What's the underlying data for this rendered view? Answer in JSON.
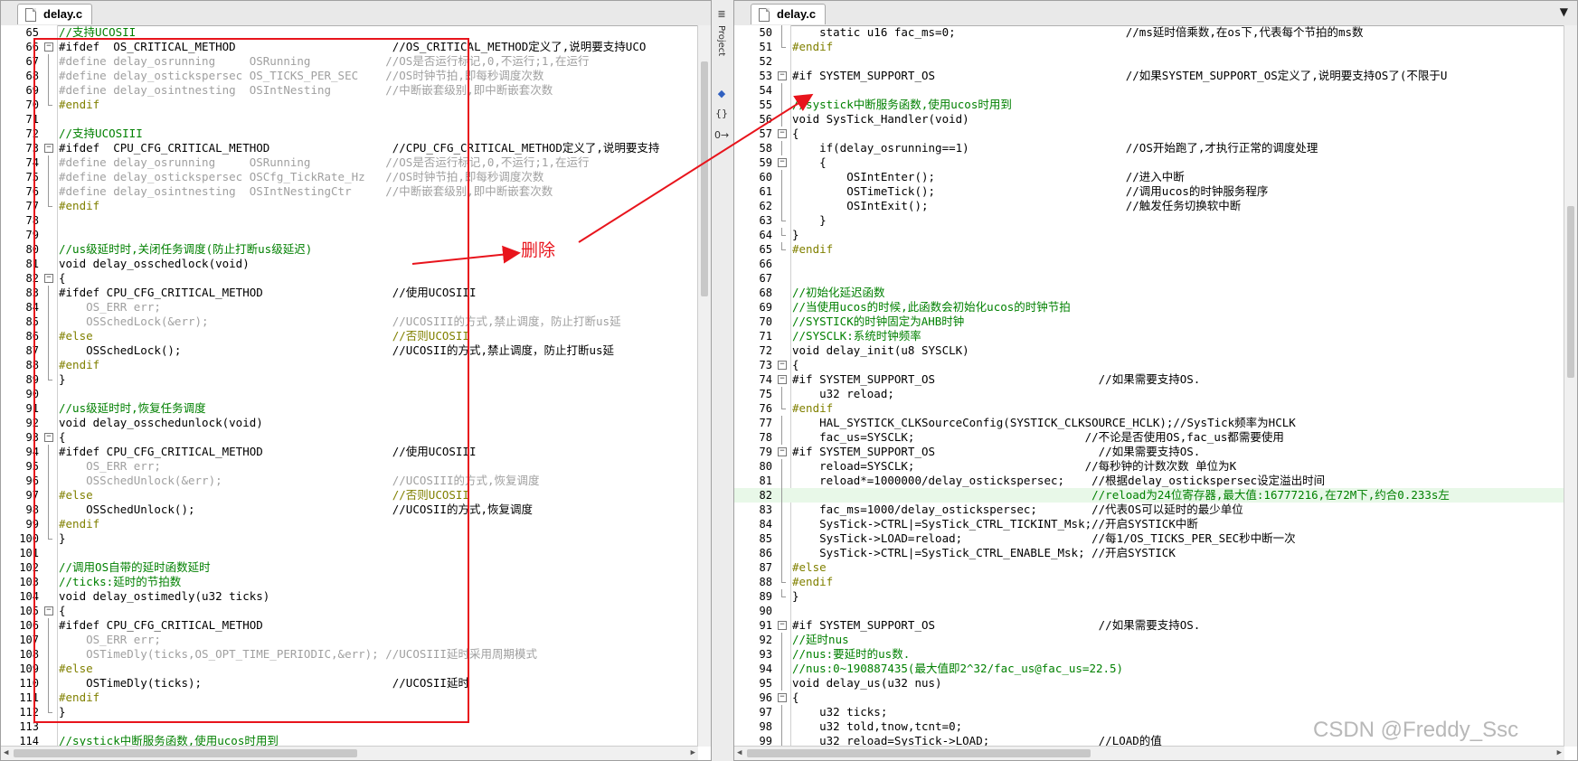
{
  "left_pane": {
    "tab": "delay.c",
    "lines": [
      {
        "n": "65",
        "t": "//支持UCOSII",
        "c": "#008000",
        "f": ""
      },
      {
        "n": "66",
        "t": "#ifdef  OS_CRITICAL_METHOD                       //OS_CRITICAL_METHOD定义了,说明要支持UCO",
        "c": "#000000",
        "f": "box"
      },
      {
        "n": "67",
        "t": "#define delay_osrunning     OSRunning           //OS是否运行标记,0,不运行;1,在运行",
        "c": "#a0a0a0",
        "f": "bar"
      },
      {
        "n": "68",
        "t": "#define delay_ostickspersec OS_TICKS_PER_SEC    //OS时钟节拍,即每秒调度次数",
        "c": "#a0a0a0",
        "f": "bar"
      },
      {
        "n": "69",
        "t": "#define delay_osintnesting  OSIntNesting        //中断嵌套级别,即中断嵌套次数",
        "c": "#a0a0a0",
        "f": "bar"
      },
      {
        "n": "70",
        "t": "#endif",
        "c": "#808000",
        "f": "end"
      },
      {
        "n": "71",
        "t": "",
        "c": "#000000",
        "f": ""
      },
      {
        "n": "72",
        "t": "//支持UCOSIII",
        "c": "#008000",
        "f": ""
      },
      {
        "n": "73",
        "t": "#ifdef  CPU_CFG_CRITICAL_METHOD                  //CPU_CFG_CRITICAL_METHOD定义了,说明要支持",
        "c": "#000000",
        "f": "box"
      },
      {
        "n": "74",
        "t": "#define delay_osrunning     OSRunning           //OS是否运行标记,0,不运行;1,在运行",
        "c": "#a0a0a0",
        "f": "bar"
      },
      {
        "n": "75",
        "t": "#define delay_ostickspersec OSCfg_TickRate_Hz   //OS时钟节拍,即每秒调度次数",
        "c": "#a0a0a0",
        "f": "bar"
      },
      {
        "n": "76",
        "t": "#define delay_osintnesting  OSIntNestingCtr     //中断嵌套级别,即中断嵌套次数",
        "c": "#a0a0a0",
        "f": "bar"
      },
      {
        "n": "77",
        "t": "#endif",
        "c": "#808000",
        "f": "end"
      },
      {
        "n": "78",
        "t": "",
        "c": "#000000",
        "f": ""
      },
      {
        "n": "79",
        "t": "",
        "c": "#000000",
        "f": ""
      },
      {
        "n": "80",
        "t": "//us级延时时,关闭任务调度(防止打断us级延迟)",
        "c": "#008000",
        "f": ""
      },
      {
        "n": "81",
        "t": "void delay_osschedlock(void)",
        "c": "#000000",
        "f": ""
      },
      {
        "n": "82",
        "t": "{",
        "c": "#000000",
        "f": "box"
      },
      {
        "n": "83",
        "t": "#ifdef CPU_CFG_CRITICAL_METHOD                   //使用UCOSIII",
        "c": "#000000",
        "f": "bar"
      },
      {
        "n": "84",
        "t": "    OS_ERR err;",
        "c": "#a0a0a0",
        "f": "bar"
      },
      {
        "n": "85",
        "t": "    OSSchedLock(&err);                           //UCOSIII的方式,禁止调度，防止打断us延",
        "c": "#a0a0a0",
        "f": "bar"
      },
      {
        "n": "86",
        "t": "#else                                            //否则UCOSII",
        "c": "#808000",
        "f": "bar"
      },
      {
        "n": "87",
        "t": "    OSSchedLock();                               //UCOSII的方式,禁止调度，防止打断us延",
        "c": "#000000",
        "f": "bar"
      },
      {
        "n": "88",
        "t": "#endif",
        "c": "#808000",
        "f": "bar"
      },
      {
        "n": "89",
        "t": "}",
        "c": "#000000",
        "f": "end"
      },
      {
        "n": "90",
        "t": "",
        "c": "#000000",
        "f": ""
      },
      {
        "n": "91",
        "t": "//us级延时时,恢复任务调度",
        "c": "#008000",
        "f": ""
      },
      {
        "n": "92",
        "t": "void delay_osschedunlock(void)",
        "c": "#000000",
        "f": ""
      },
      {
        "n": "93",
        "t": "{",
        "c": "#000000",
        "f": "box"
      },
      {
        "n": "94",
        "t": "#ifdef CPU_CFG_CRITICAL_METHOD                   //使用UCOSIII",
        "c": "#000000",
        "f": "bar"
      },
      {
        "n": "95",
        "t": "    OS_ERR err;",
        "c": "#a0a0a0",
        "f": "bar"
      },
      {
        "n": "96",
        "t": "    OSSchedUnlock(&err);                         //UCOSIII的方式,恢复调度",
        "c": "#a0a0a0",
        "f": "bar"
      },
      {
        "n": "97",
        "t": "#else                                            //否则UCOSII",
        "c": "#808000",
        "f": "bar"
      },
      {
        "n": "98",
        "t": "    OSSchedUnlock();                             //UCOSII的方式,恢复调度",
        "c": "#000000",
        "f": "bar"
      },
      {
        "n": "99",
        "t": "#endif",
        "c": "#808000",
        "f": "bar"
      },
      {
        "n": "100",
        "t": "}",
        "c": "#000000",
        "f": "end"
      },
      {
        "n": "101",
        "t": "",
        "c": "#000000",
        "f": ""
      },
      {
        "n": "102",
        "t": "//调用OS自带的延时函数延时",
        "c": "#008000",
        "f": ""
      },
      {
        "n": "103",
        "t": "//ticks:延时的节拍数",
        "c": "#008000",
        "f": ""
      },
      {
        "n": "104",
        "t": "void delay_ostimedly(u32 ticks)",
        "c": "#000000",
        "f": ""
      },
      {
        "n": "105",
        "t": "{",
        "c": "#000000",
        "f": "box"
      },
      {
        "n": "106",
        "t": "#ifdef CPU_CFG_CRITICAL_METHOD",
        "c": "#000000",
        "f": "bar"
      },
      {
        "n": "107",
        "t": "    OS_ERR err;",
        "c": "#a0a0a0",
        "f": "bar"
      },
      {
        "n": "108",
        "t": "    OSTimeDly(ticks,OS_OPT_TIME_PERIODIC,&err); //UCOSIII延时采用周期模式",
        "c": "#a0a0a0",
        "f": "bar"
      },
      {
        "n": "109",
        "t": "#else",
        "c": "#808000",
        "f": "bar"
      },
      {
        "n": "110",
        "t": "    OSTimeDly(ticks);                            //UCOSII延时",
        "c": "#000000",
        "f": "bar"
      },
      {
        "n": "111",
        "t": "#endif",
        "c": "#808000",
        "f": "bar"
      },
      {
        "n": "112",
        "t": "}",
        "c": "#000000",
        "f": "end"
      },
      {
        "n": "113",
        "t": "",
        "c": "#000000",
        "f": ""
      },
      {
        "n": "114",
        "t": "//systick中断服务函数,使用ucos时用到",
        "c": "#008000",
        "f": ""
      }
    ]
  },
  "right_pane": {
    "tab": "delay.c",
    "lines": [
      {
        "n": "50",
        "t": "    static u16 fac_ms=0;                         //ms延时倍乘数,在os下,代表每个节拍的ms数",
        "c": "#000000",
        "f": "bar"
      },
      {
        "n": "51",
        "t": "#endif",
        "c": "#808000",
        "f": "end"
      },
      {
        "n": "52",
        "t": "",
        "c": "#000000",
        "f": ""
      },
      {
        "n": "53",
        "t": "#if SYSTEM_SUPPORT_OS                            //如果SYSTEM_SUPPORT_OS定义了,说明要支持OS了(不限于U",
        "c": "#000000",
        "f": "box"
      },
      {
        "n": "54",
        "t": "",
        "c": "#000000",
        "f": "bar"
      },
      {
        "n": "55",
        "t": "//systick中断服务函数,使用ucos时用到",
        "c": "#008000",
        "f": "bar"
      },
      {
        "n": "56",
        "t": "void SysTick_Handler(void)",
        "c": "#000000",
        "f": "bar"
      },
      {
        "n": "57",
        "t": "{",
        "c": "#000000",
        "f": "box"
      },
      {
        "n": "58",
        "t": "    if(delay_osrunning==1)                       //OS开始跑了,才执行正常的调度处理",
        "c": "#000000",
        "f": "bar"
      },
      {
        "n": "59",
        "t": "    {",
        "c": "#000000",
        "f": "box"
      },
      {
        "n": "60",
        "t": "        OSIntEnter();                            //进入中断",
        "c": "#000000",
        "f": "bar"
      },
      {
        "n": "61",
        "t": "        OSTimeTick();                            //调用ucos的时钟服务程序",
        "c": "#000000",
        "f": "bar"
      },
      {
        "n": "62",
        "t": "        OSIntExit();                             //触发任务切换软中断",
        "c": "#000000",
        "f": "bar"
      },
      {
        "n": "63",
        "t": "    }",
        "c": "#000000",
        "f": "end"
      },
      {
        "n": "64",
        "t": "}",
        "c": "#000000",
        "f": "end"
      },
      {
        "n": "65",
        "t": "#endif",
        "c": "#808000",
        "f": "end"
      },
      {
        "n": "66",
        "t": "",
        "c": "#000000",
        "f": ""
      },
      {
        "n": "67",
        "t": "",
        "c": "#000000",
        "f": ""
      },
      {
        "n": "68",
        "t": "//初始化延迟函数",
        "c": "#008000",
        "f": ""
      },
      {
        "n": "69",
        "t": "//当使用ucos的时候,此函数会初始化ucos的时钟节拍",
        "c": "#008000",
        "f": ""
      },
      {
        "n": "70",
        "t": "//SYSTICK的时钟固定为AHB时钟",
        "c": "#008000",
        "f": ""
      },
      {
        "n": "71",
        "t": "//SYSCLK:系统时钟频率",
        "c": "#008000",
        "f": ""
      },
      {
        "n": "72",
        "t": "void delay_init(u8 SYSCLK)",
        "c": "#000000",
        "f": ""
      },
      {
        "n": "73",
        "t": "{",
        "c": "#000000",
        "f": "box"
      },
      {
        "n": "74",
        "t": "#if SYSTEM_SUPPORT_OS                        //如果需要支持OS.",
        "c": "#000000",
        "f": "box"
      },
      {
        "n": "75",
        "t": "    u32 reload;",
        "c": "#000000",
        "f": "bar"
      },
      {
        "n": "76",
        "t": "#endif",
        "c": "#808000",
        "f": "end"
      },
      {
        "n": "77",
        "t": "    HAL_SYSTICK_CLKSourceConfig(SYSTICK_CLKSOURCE_HCLK);//SysTick频率为HCLK",
        "c": "#000000",
        "f": "bar"
      },
      {
        "n": "78",
        "t": "    fac_us=SYSCLK;                         //不论是否使用OS,fac_us都需要使用",
        "c": "#000000",
        "f": "bar"
      },
      {
        "n": "79",
        "t": "#if SYSTEM_SUPPORT_OS                        //如果需要支持OS.",
        "c": "#000000",
        "f": "box"
      },
      {
        "n": "80",
        "t": "    reload=SYSCLK;                         //每秒钟的计数次数 单位为K",
        "c": "#000000",
        "f": "bar"
      },
      {
        "n": "81",
        "t": "    reload*=1000000/delay_ostickspersec;    //根据delay_ostickspersec设定溢出时间",
        "c": "#000000",
        "f": "bar"
      },
      {
        "n": "82",
        "t": "                                            //reload为24位寄存器,最大值:16777216,在72M下,约合0.233s左",
        "c": "#008000",
        "f": "bar",
        "hl": true
      },
      {
        "n": "83",
        "t": "    fac_ms=1000/delay_ostickspersec;        //代表OS可以延时的最少单位",
        "c": "#000000",
        "f": "bar"
      },
      {
        "n": "84",
        "t": "    SysTick->CTRL|=SysTick_CTRL_TICKINT_Msk;//开启SYSTICK中断",
        "c": "#000000",
        "f": "bar"
      },
      {
        "n": "85",
        "t": "    SysTick->LOAD=reload;                   //每1/OS_TICKS_PER_SEC秒中断一次",
        "c": "#000000",
        "f": "bar"
      },
      {
        "n": "86",
        "t": "    SysTick->CTRL|=SysTick_CTRL_ENABLE_Msk; //开启SYSTICK",
        "c": "#000000",
        "f": "bar"
      },
      {
        "n": "87",
        "t": "#else",
        "c": "#808000",
        "f": "bar"
      },
      {
        "n": "88",
        "t": "#endif",
        "c": "#808000",
        "f": "end"
      },
      {
        "n": "89",
        "t": "}",
        "c": "#000000",
        "f": "end"
      },
      {
        "n": "90",
        "t": "",
        "c": "#000000",
        "f": ""
      },
      {
        "n": "91",
        "t": "#if SYSTEM_SUPPORT_OS                        //如果需要支持OS.",
        "c": "#000000",
        "f": "box"
      },
      {
        "n": "92",
        "t": "//延时nus",
        "c": "#008000",
        "f": "bar"
      },
      {
        "n": "93",
        "t": "//nus:要延时的us数.",
        "c": "#008000",
        "f": "bar"
      },
      {
        "n": "94",
        "t": "//nus:0~190887435(最大值即2^32/fac_us@fac_us=22.5)",
        "c": "#008000",
        "f": "bar"
      },
      {
        "n": "95",
        "t": "void delay_us(u32 nus)",
        "c": "#000000",
        "f": "bar"
      },
      {
        "n": "96",
        "t": "{",
        "c": "#000000",
        "f": "box"
      },
      {
        "n": "97",
        "t": "    u32 ticks;",
        "c": "#000000",
        "f": "bar"
      },
      {
        "n": "98",
        "t": "    u32 told,tnow,tcnt=0;",
        "c": "#000000",
        "f": "bar"
      },
      {
        "n": "99",
        "t": "    u32 reload=SysTick->LOAD;                //LOAD的值",
        "c": "#000000",
        "f": "bar"
      }
    ]
  },
  "sidebar": {
    "label": "Project",
    "btn1": "≣",
    "btn2": "{}",
    "btn3": "0→"
  },
  "annotation": {
    "label": "删除",
    "color": "#e8141c"
  },
  "watermark": "CSDN @Freddy_Ssc"
}
